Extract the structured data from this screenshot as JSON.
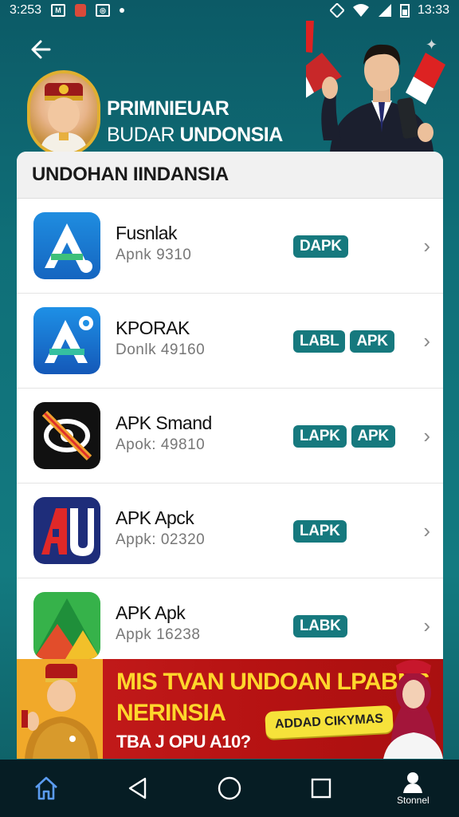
{
  "status_bar": {
    "time_left": "3:253",
    "time_right": "13:33"
  },
  "header": {
    "line1": "PRIMNIEUAR",
    "line2a": "BUDAR",
    "line2b": "UNDONSIA"
  },
  "card": {
    "title": "UNDOHAN IINDANSIA",
    "apps": [
      {
        "name": "Fusnlak",
        "sub": "Apnk  9310",
        "badges": [
          "DAPK"
        ]
      },
      {
        "name": "KPORAK",
        "sub": "Donlk  49160",
        "badges": [
          "LABL",
          "APK"
        ]
      },
      {
        "name": "APK Smand",
        "sub": "Apok:  49810",
        "badges": [
          "LAPK",
          "APK"
        ]
      },
      {
        "name": "APK Apck",
        "sub": "Appk:  02320",
        "badges": [
          "LAPK"
        ]
      },
      {
        "name": "APK Apk",
        "sub": "Appk  16238",
        "badges": [
          "LABK"
        ]
      }
    ]
  },
  "banner": {
    "line1": "MIS TVAN UNDOAN LPABNS",
    "line2": "NERINSIA",
    "line3": "TBA J OPU A10?",
    "button": "ADDAD CIKYMAS"
  },
  "nav": {
    "profile_label": "Stonnel"
  },
  "colors": {
    "accent": "#16797e",
    "banner_red": "#c71d1d",
    "banner_yellow": "#ffd72c"
  }
}
